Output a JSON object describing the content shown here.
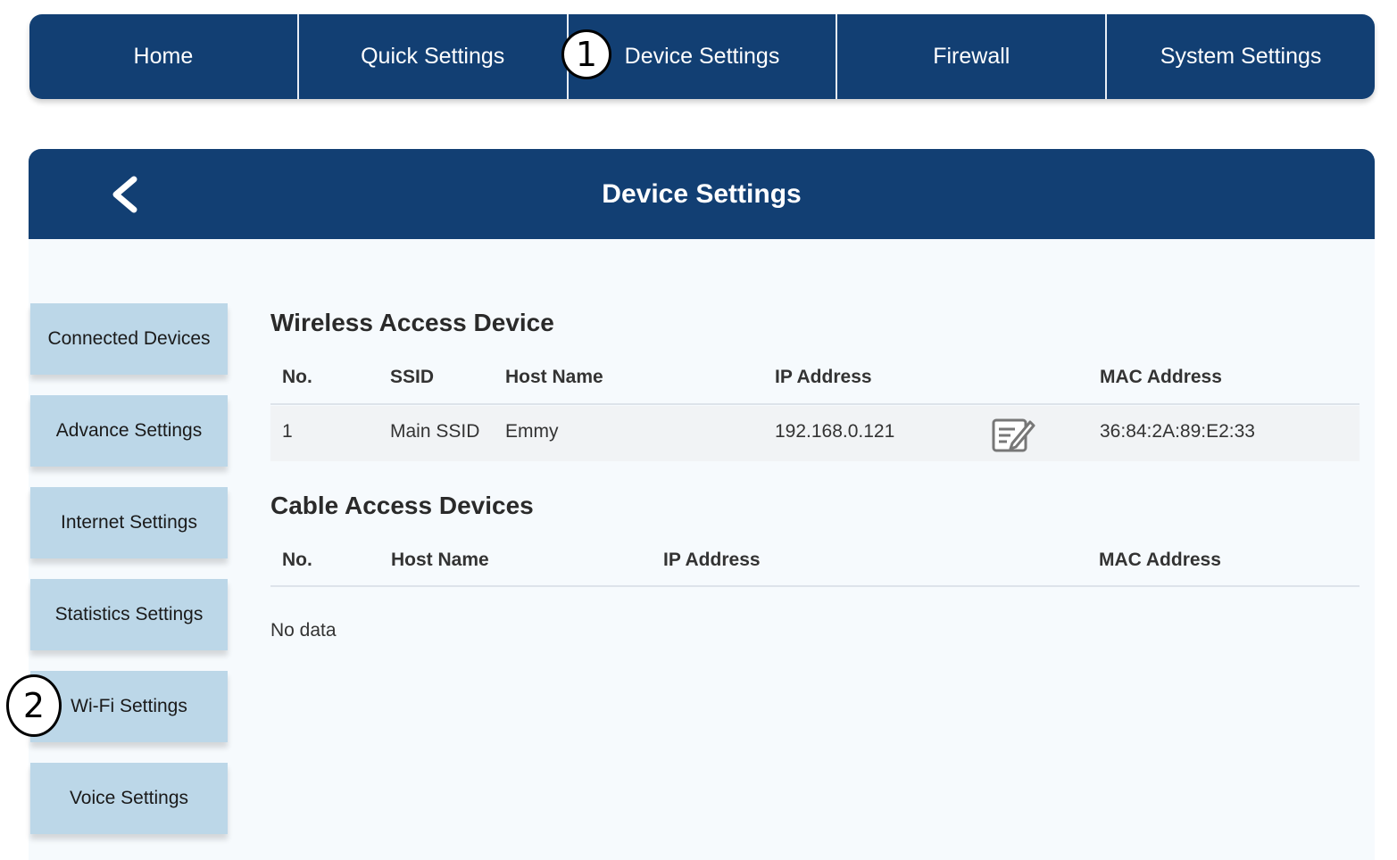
{
  "topnav": {
    "tabs": [
      {
        "label": "Home"
      },
      {
        "label": "Quick Settings"
      },
      {
        "label": "Device Settings"
      },
      {
        "label": "Firewall"
      },
      {
        "label": "System Settings"
      }
    ]
  },
  "callouts": {
    "one": "1",
    "two": "2"
  },
  "header": {
    "title": "Device Settings",
    "back_icon": "chevron-left-icon"
  },
  "sidebar": {
    "items": [
      {
        "label": "Connected Devices"
      },
      {
        "label": "Advance Settings"
      },
      {
        "label": "Internet Settings"
      },
      {
        "label": "Statistics Settings"
      },
      {
        "label": "Wi-Fi Settings"
      },
      {
        "label": "Voice Settings"
      }
    ]
  },
  "wireless": {
    "title": "Wireless Access Device",
    "columns": {
      "no": "No.",
      "ssid": "SSID",
      "host": "Host Name",
      "ip": "IP Address",
      "mac": "MAC Address"
    },
    "rows": [
      {
        "no": "1",
        "ssid": "Main SSID",
        "host": "Emmy",
        "ip": "192.168.0.121",
        "mac": "36:84:2A:89:E2:33"
      }
    ],
    "edit_icon": "edit-icon"
  },
  "cable": {
    "title": "Cable Access Devices",
    "columns": {
      "no": "No.",
      "host": "Host Name",
      "ip": "IP Address",
      "mac": "MAC Address"
    },
    "empty_text": "No data"
  },
  "colors": {
    "navy": "#123f73",
    "side_button": "#bcd7e8",
    "panel": "#f6fafd"
  }
}
